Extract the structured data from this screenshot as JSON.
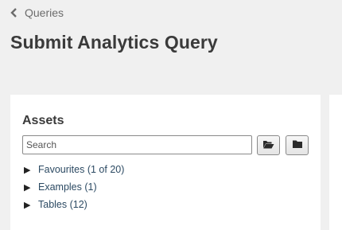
{
  "breadcrumb": {
    "label": "Queries",
    "icon": "chevron-left-icon"
  },
  "page": {
    "title": "Submit Analytics Query"
  },
  "assets": {
    "title": "Assets",
    "search": {
      "placeholder": "Search",
      "value": ""
    },
    "buttons": [
      {
        "icon": "folder-open-icon"
      },
      {
        "icon": "folder-icon"
      }
    ],
    "items": [
      {
        "label": "Favourites (1 of 20)",
        "arrow": "▶"
      },
      {
        "label": "Examples (1)",
        "arrow": "▶"
      },
      {
        "label": "Tables (12)",
        "arrow": "▶"
      }
    ]
  },
  "colors": {
    "background": "#f0f0f0",
    "panel": "#ffffff",
    "link": "#2c4a63",
    "title": "#3a3a3a"
  }
}
